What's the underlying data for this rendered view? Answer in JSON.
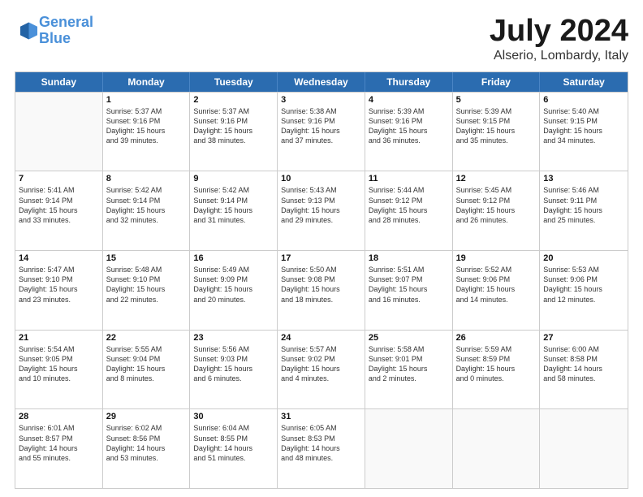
{
  "header": {
    "logo_line1": "General",
    "logo_line2": "Blue",
    "title": "July 2024",
    "subtitle": "Alserio, Lombardy, Italy"
  },
  "weekdays": [
    "Sunday",
    "Monday",
    "Tuesday",
    "Wednesday",
    "Thursday",
    "Friday",
    "Saturday"
  ],
  "weeks": [
    [
      {
        "day": "",
        "info": ""
      },
      {
        "day": "1",
        "info": "Sunrise: 5:37 AM\nSunset: 9:16 PM\nDaylight: 15 hours\nand 39 minutes."
      },
      {
        "day": "2",
        "info": "Sunrise: 5:37 AM\nSunset: 9:16 PM\nDaylight: 15 hours\nand 38 minutes."
      },
      {
        "day": "3",
        "info": "Sunrise: 5:38 AM\nSunset: 9:16 PM\nDaylight: 15 hours\nand 37 minutes."
      },
      {
        "day": "4",
        "info": "Sunrise: 5:39 AM\nSunset: 9:16 PM\nDaylight: 15 hours\nand 36 minutes."
      },
      {
        "day": "5",
        "info": "Sunrise: 5:39 AM\nSunset: 9:15 PM\nDaylight: 15 hours\nand 35 minutes."
      },
      {
        "day": "6",
        "info": "Sunrise: 5:40 AM\nSunset: 9:15 PM\nDaylight: 15 hours\nand 34 minutes."
      }
    ],
    [
      {
        "day": "7",
        "info": "Sunrise: 5:41 AM\nSunset: 9:14 PM\nDaylight: 15 hours\nand 33 minutes."
      },
      {
        "day": "8",
        "info": "Sunrise: 5:42 AM\nSunset: 9:14 PM\nDaylight: 15 hours\nand 32 minutes."
      },
      {
        "day": "9",
        "info": "Sunrise: 5:42 AM\nSunset: 9:14 PM\nDaylight: 15 hours\nand 31 minutes."
      },
      {
        "day": "10",
        "info": "Sunrise: 5:43 AM\nSunset: 9:13 PM\nDaylight: 15 hours\nand 29 minutes."
      },
      {
        "day": "11",
        "info": "Sunrise: 5:44 AM\nSunset: 9:12 PM\nDaylight: 15 hours\nand 28 minutes."
      },
      {
        "day": "12",
        "info": "Sunrise: 5:45 AM\nSunset: 9:12 PM\nDaylight: 15 hours\nand 26 minutes."
      },
      {
        "day": "13",
        "info": "Sunrise: 5:46 AM\nSunset: 9:11 PM\nDaylight: 15 hours\nand 25 minutes."
      }
    ],
    [
      {
        "day": "14",
        "info": "Sunrise: 5:47 AM\nSunset: 9:10 PM\nDaylight: 15 hours\nand 23 minutes."
      },
      {
        "day": "15",
        "info": "Sunrise: 5:48 AM\nSunset: 9:10 PM\nDaylight: 15 hours\nand 22 minutes."
      },
      {
        "day": "16",
        "info": "Sunrise: 5:49 AM\nSunset: 9:09 PM\nDaylight: 15 hours\nand 20 minutes."
      },
      {
        "day": "17",
        "info": "Sunrise: 5:50 AM\nSunset: 9:08 PM\nDaylight: 15 hours\nand 18 minutes."
      },
      {
        "day": "18",
        "info": "Sunrise: 5:51 AM\nSunset: 9:07 PM\nDaylight: 15 hours\nand 16 minutes."
      },
      {
        "day": "19",
        "info": "Sunrise: 5:52 AM\nSunset: 9:06 PM\nDaylight: 15 hours\nand 14 minutes."
      },
      {
        "day": "20",
        "info": "Sunrise: 5:53 AM\nSunset: 9:06 PM\nDaylight: 15 hours\nand 12 minutes."
      }
    ],
    [
      {
        "day": "21",
        "info": "Sunrise: 5:54 AM\nSunset: 9:05 PM\nDaylight: 15 hours\nand 10 minutes."
      },
      {
        "day": "22",
        "info": "Sunrise: 5:55 AM\nSunset: 9:04 PM\nDaylight: 15 hours\nand 8 minutes."
      },
      {
        "day": "23",
        "info": "Sunrise: 5:56 AM\nSunset: 9:03 PM\nDaylight: 15 hours\nand 6 minutes."
      },
      {
        "day": "24",
        "info": "Sunrise: 5:57 AM\nSunset: 9:02 PM\nDaylight: 15 hours\nand 4 minutes."
      },
      {
        "day": "25",
        "info": "Sunrise: 5:58 AM\nSunset: 9:01 PM\nDaylight: 15 hours\nand 2 minutes."
      },
      {
        "day": "26",
        "info": "Sunrise: 5:59 AM\nSunset: 8:59 PM\nDaylight: 15 hours\nand 0 minutes."
      },
      {
        "day": "27",
        "info": "Sunrise: 6:00 AM\nSunset: 8:58 PM\nDaylight: 14 hours\nand 58 minutes."
      }
    ],
    [
      {
        "day": "28",
        "info": "Sunrise: 6:01 AM\nSunset: 8:57 PM\nDaylight: 14 hours\nand 55 minutes."
      },
      {
        "day": "29",
        "info": "Sunrise: 6:02 AM\nSunset: 8:56 PM\nDaylight: 14 hours\nand 53 minutes."
      },
      {
        "day": "30",
        "info": "Sunrise: 6:04 AM\nSunset: 8:55 PM\nDaylight: 14 hours\nand 51 minutes."
      },
      {
        "day": "31",
        "info": "Sunrise: 6:05 AM\nSunset: 8:53 PM\nDaylight: 14 hours\nand 48 minutes."
      },
      {
        "day": "",
        "info": ""
      },
      {
        "day": "",
        "info": ""
      },
      {
        "day": "",
        "info": ""
      }
    ]
  ]
}
